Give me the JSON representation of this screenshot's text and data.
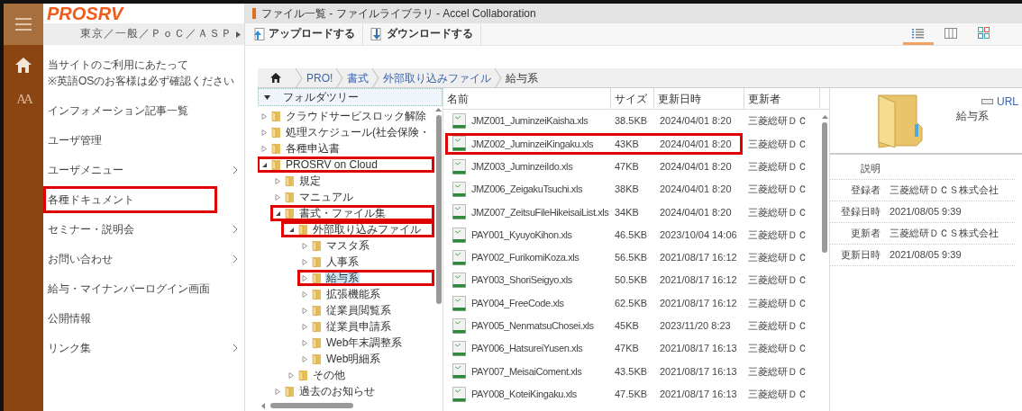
{
  "sidebar": {
    "logo": "PROSRV",
    "font_button": "AA",
    "context": "東京／一般／ＰｏＣ／ＡＳＰ",
    "items": [
      {
        "label": "当サイトのご利用にあたって\n※英語OSのお客様は必ず確認ください",
        "submenu": false,
        "highlighted": false
      },
      {
        "label": "インフォメーション記事一覧",
        "submenu": false,
        "highlighted": false
      },
      {
        "label": "ユーザ管理",
        "submenu": false,
        "highlighted": false
      },
      {
        "label": "ユーザメニュー",
        "submenu": true,
        "highlighted": false
      },
      {
        "label": "各種ドキュメント",
        "submenu": false,
        "highlighted": true
      },
      {
        "label": "セミナー・説明会",
        "submenu": true,
        "highlighted": false
      },
      {
        "label": "お問い合わせ",
        "submenu": true,
        "highlighted": false
      },
      {
        "label": "給与・マイナンバーログイン画面",
        "submenu": false,
        "highlighted": false
      },
      {
        "label": "公開情報",
        "submenu": false,
        "highlighted": false
      },
      {
        "label": "リンク集",
        "submenu": true,
        "highlighted": false
      }
    ]
  },
  "window": {
    "title": "ファイル一覧 - ファイルライブラリ - Accel Collaboration"
  },
  "toolbar": {
    "buttons": [
      {
        "kind": "upload",
        "label": "アップロードする"
      },
      {
        "kind": "download",
        "label": "ダウンロードする"
      }
    ],
    "views": [
      {
        "kind": "list",
        "selected": true
      },
      {
        "kind": "columns",
        "selected": false
      },
      {
        "kind": "grid",
        "selected": false
      }
    ]
  },
  "breadcrumb": [
    "PRO!",
    "書式",
    "外部取り込みファイル",
    "給与系"
  ],
  "tree": {
    "title": "フォルダツリー",
    "nodes": [
      {
        "label": "クラウドサービスロック解除",
        "expanded": false,
        "selected": false,
        "highlighted": false
      },
      {
        "label": "処理スケジュール(社会保険・",
        "expanded": false,
        "selected": false,
        "highlighted": false
      },
      {
        "label": "各種申込書",
        "expanded": false,
        "selected": false,
        "highlighted": false
      },
      {
        "label": "PROSRV on Cloud",
        "expanded": true,
        "selected": false,
        "highlighted": true,
        "children": [
          {
            "label": "規定",
            "expanded": false,
            "selected": false,
            "highlighted": false
          },
          {
            "label": "マニュアル",
            "expanded": false,
            "selected": false,
            "highlighted": false
          },
          {
            "label": "書式・ファイル集",
            "expanded": true,
            "selected": false,
            "highlighted": true,
            "children": [
              {
                "label": "外部取り込みファイル",
                "expanded": true,
                "selected": false,
                "highlighted": true,
                "children": [
                  {
                    "label": "マスタ系",
                    "expanded": false,
                    "selected": false,
                    "highlighted": false
                  },
                  {
                    "label": "人事系",
                    "expanded": false,
                    "selected": false,
                    "highlighted": false
                  },
                  {
                    "label": "給与系",
                    "expanded": false,
                    "selected": true,
                    "highlighted": true
                  },
                  {
                    "label": "拡張機能系",
                    "expanded": false,
                    "selected": false,
                    "highlighted": false
                  },
                  {
                    "label": "従業員閲覧系",
                    "expanded": false,
                    "selected": false,
                    "highlighted": false
                  },
                  {
                    "label": "従業員申請系",
                    "expanded": false,
                    "selected": false,
                    "highlighted": false
                  },
                  {
                    "label": "Web年末調整系",
                    "expanded": false,
                    "selected": false,
                    "highlighted": false
                  },
                  {
                    "label": "Web明細系",
                    "expanded": false,
                    "selected": false,
                    "highlighted": false
                  }
                ]
              },
              {
                "label": "その他",
                "expanded": false,
                "selected": false,
                "highlighted": false
              }
            ]
          },
          {
            "label": "過去のお知らせ",
            "expanded": false,
            "selected": false,
            "highlighted": false
          }
        ]
      }
    ]
  },
  "files": {
    "columns": [
      "名前",
      "サイズ",
      "更新日時",
      "更新者"
    ],
    "rows": [
      {
        "name": "JMZ001_JuminzeiKaisha.xls",
        "size": "38.5KB",
        "updated": "2024/04/01 8:20",
        "by": "三菱総研ＤＣ",
        "highlighted": false
      },
      {
        "name": "JMZ002_JuminzeiKingaku.xls",
        "size": "43KB",
        "updated": "2024/04/01 8:20",
        "by": "三菱総研ＤＣ",
        "highlighted": true
      },
      {
        "name": "JMZ003_JuminzeiIdo.xls",
        "size": "47KB",
        "updated": "2024/04/01 8:20",
        "by": "三菱総研ＤＣ",
        "highlighted": false
      },
      {
        "name": "JMZ006_ZeigakuTsuchi.xls",
        "size": "38KB",
        "updated": "2024/04/01 8:20",
        "by": "三菱総研ＤＣ",
        "highlighted": false
      },
      {
        "name": "JMZ007_ZeitsuFileHikeisaiList.xls",
        "size": "34KB",
        "updated": "2024/04/01 8:20",
        "by": "三菱総研ＤＣ",
        "highlighted": false
      },
      {
        "name": "PAY001_KyuyoKihon.xls",
        "size": "46.5KB",
        "updated": "2023/10/04 14:06",
        "by": "三菱総研ＤＣ",
        "highlighted": false
      },
      {
        "name": "PAY002_FurikomiKoza.xls",
        "size": "56.5KB",
        "updated": "2021/08/17 16:12",
        "by": "三菱総研ＤＣ",
        "highlighted": false
      },
      {
        "name": "PAY003_ShoriSeigyo.xls",
        "size": "50.5KB",
        "updated": "2021/08/17 16:12",
        "by": "三菱総研ＤＣ",
        "highlighted": false
      },
      {
        "name": "PAY004_FreeCode.xls",
        "size": "62.5KB",
        "updated": "2021/08/17 16:12",
        "by": "三菱総研ＤＣ",
        "highlighted": false
      },
      {
        "name": "PAY005_NenmatsuChosei.xls",
        "size": "45KB",
        "updated": "2023/11/20 8:23",
        "by": "三菱総研ＤＣ",
        "highlighted": false
      },
      {
        "name": "PAY006_HatsureiYusen.xls",
        "size": "47KB",
        "updated": "2021/08/17 16:13",
        "by": "三菱総研ＤＣ",
        "highlighted": false
      },
      {
        "name": "PAY007_MeisaiComent.xls",
        "size": "43.5KB",
        "updated": "2021/08/17 16:13",
        "by": "三菱総研ＤＣ",
        "highlighted": false
      },
      {
        "name": "PAY008_KoteiKingaku.xls",
        "size": "47.5KB",
        "updated": "2021/08/17 16:13",
        "by": "三菱総研ＤＣ",
        "highlighted": false
      }
    ]
  },
  "detail": {
    "url_link": "URL",
    "name": "給与系",
    "fields": [
      {
        "label": "説明"
      },
      {
        "label": "登録者",
        "value": "三菱総研ＤＣＳ株式会社"
      },
      {
        "label": "登録日時",
        "value": "2021/08/05 9:39"
      },
      {
        "label": "更新者",
        "value": "三菱総研ＤＣＳ株式会社"
      },
      {
        "label": "更新日時",
        "value": "2021/08/05 9:39"
      }
    ]
  }
}
